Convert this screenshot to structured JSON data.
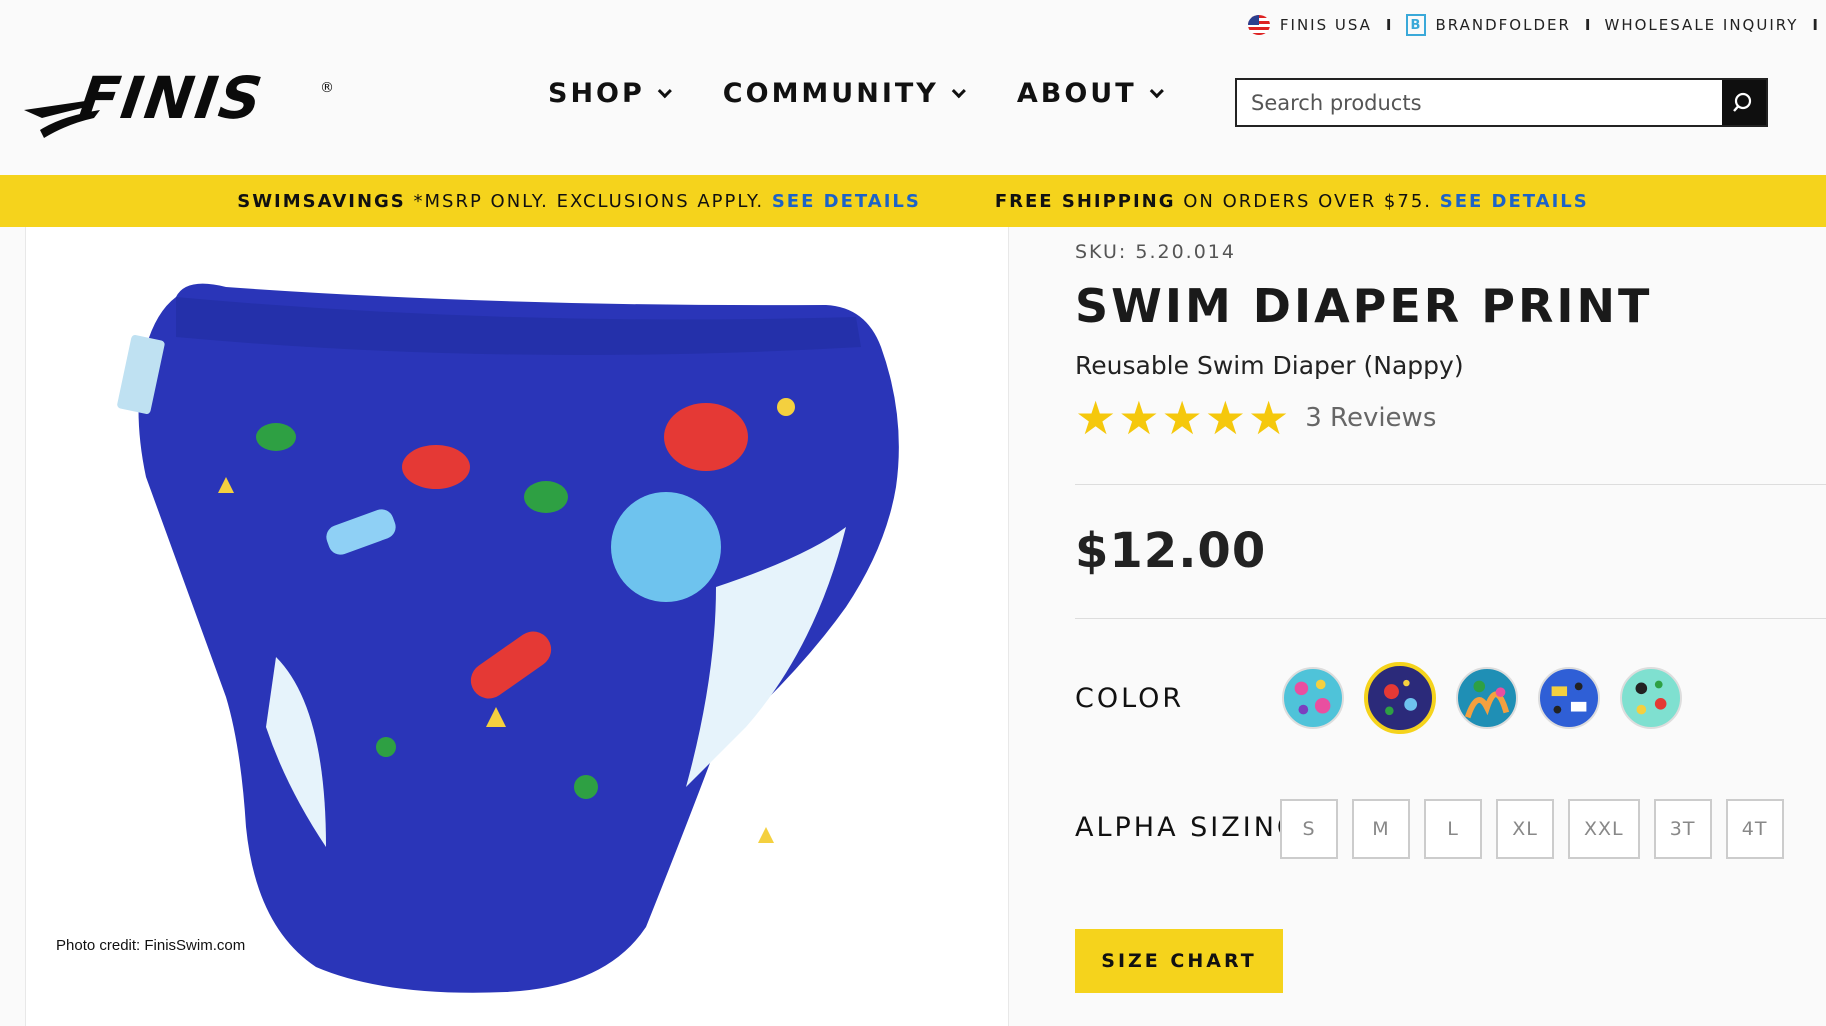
{
  "utility": {
    "region": "FINIS USA",
    "brandfolder": "BRANDFOLDER",
    "brandfolder_icon_letter": "B",
    "wholesale": "WHOLESALE INQUIRY",
    "separator": "I"
  },
  "brand": {
    "logo_text": "FINIS",
    "reg_mark": "®"
  },
  "nav": {
    "items": [
      {
        "label": "SHOP"
      },
      {
        "label": "COMMUNITY"
      },
      {
        "label": "ABOUT"
      }
    ]
  },
  "search": {
    "placeholder": "Search products",
    "value": ""
  },
  "promo": {
    "left_bold": "SWIMSAVINGS",
    "left_text": " *MSRP ONLY. EXCLUSIONS APPLY. ",
    "left_link": "SEE DETAILS",
    "right_bold": "FREE SHIPPING",
    "right_text": " ON ORDERS OVER $75. ",
    "right_link": "SEE DETAILS"
  },
  "product": {
    "sku": "SKU: 5.20.014",
    "title": "SWIM DIAPER PRINT",
    "subtitle": "Reusable Swim Diaper (Nappy)",
    "rating": 5,
    "reviews": "3 Reviews",
    "price": "$12.00",
    "color_label": "COLOR",
    "sizing_label": "ALPHA SIZING",
    "sizes": [
      "S",
      "M",
      "L",
      "XL",
      "XXL",
      "3T",
      "4T"
    ],
    "size_chart": "SIZE CHART",
    "selected_color_index": 1,
    "swatch_colors": [
      "#4fc3d9",
      "#2b2a7a",
      "#1f8fb5",
      "#2f5fd6",
      "#7fe0d0"
    ]
  },
  "image": {
    "credit": "Photo credit: FinisSwim.com",
    "main_color": "#2a35b8"
  }
}
